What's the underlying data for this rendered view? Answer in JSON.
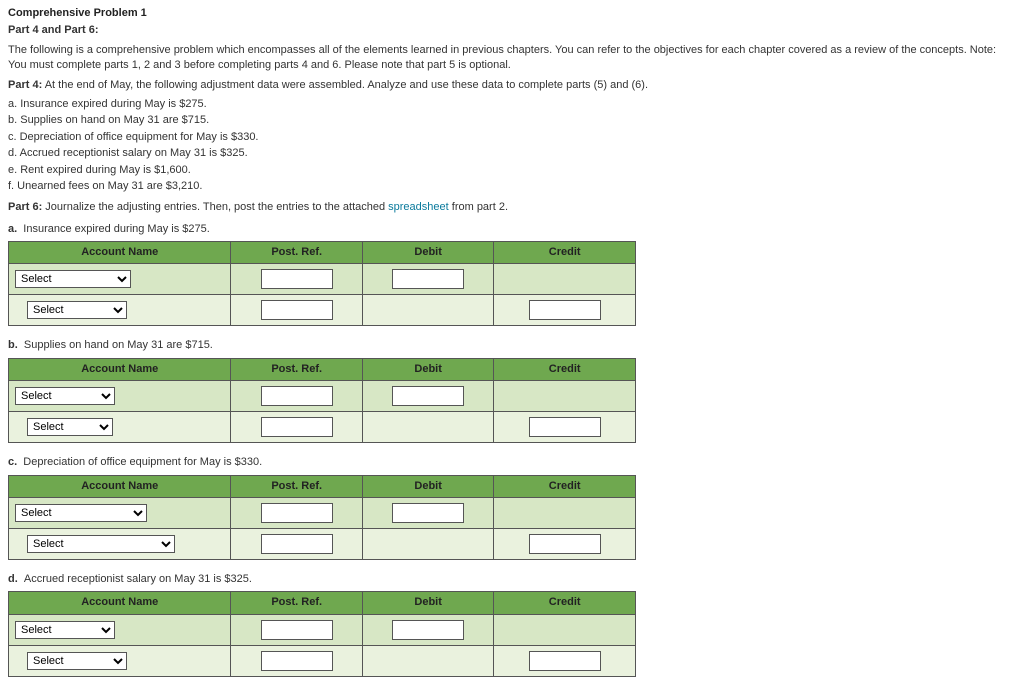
{
  "heading": {
    "title": "Comprehensive Problem 1",
    "subtitle": "Part 4 and Part 6:"
  },
  "intro": "The following is a comprehensive problem which encompasses all of the elements learned in previous chapters. You can refer to the objectives for each chapter covered as a review of the concepts. Note: You must complete parts 1, 2 and 3 before completing parts 4 and 6. Please note that part 5 is optional.",
  "part4": {
    "label": "Part 4:",
    "text": " At the end of May, the following adjustment data were assembled. Analyze and use these data to complete parts (5) and (6).",
    "items": [
      "a. Insurance expired during May is $275.",
      "b. Supplies on hand on May 31 are $715.",
      "c. Depreciation of office equipment for May is $330.",
      "d. Accrued receptionist salary on May 31 is $325.",
      "e. Rent expired during May is $1,600.",
      "f. Unearned fees on May 31 are $3,210."
    ]
  },
  "part6": {
    "label": "Part 6:",
    "text_a": " Journalize the adjusting entries. Then, post the entries to the attached ",
    "link": "spreadsheet",
    "text_b": " from part 2."
  },
  "cols": {
    "acct": "Account Name",
    "pr": "Post. Ref.",
    "debit": "Debit",
    "credit": "Credit"
  },
  "select_label": "Select",
  "entries": [
    {
      "letter": "a.",
      "text": "Insurance expired during May is $275.",
      "w1": 116,
      "w2": 100
    },
    {
      "letter": "b.",
      "text": "Supplies on hand on May 31 are $715.",
      "w1": 100,
      "w2": 86
    },
    {
      "letter": "c.",
      "text": "Depreciation of office equipment for May is $330.",
      "w1": 132,
      "w2": 148
    },
    {
      "letter": "d.",
      "text": "Accrued receptionist salary on May 31 is $325.",
      "w1": 100,
      "w2": 100
    }
  ]
}
